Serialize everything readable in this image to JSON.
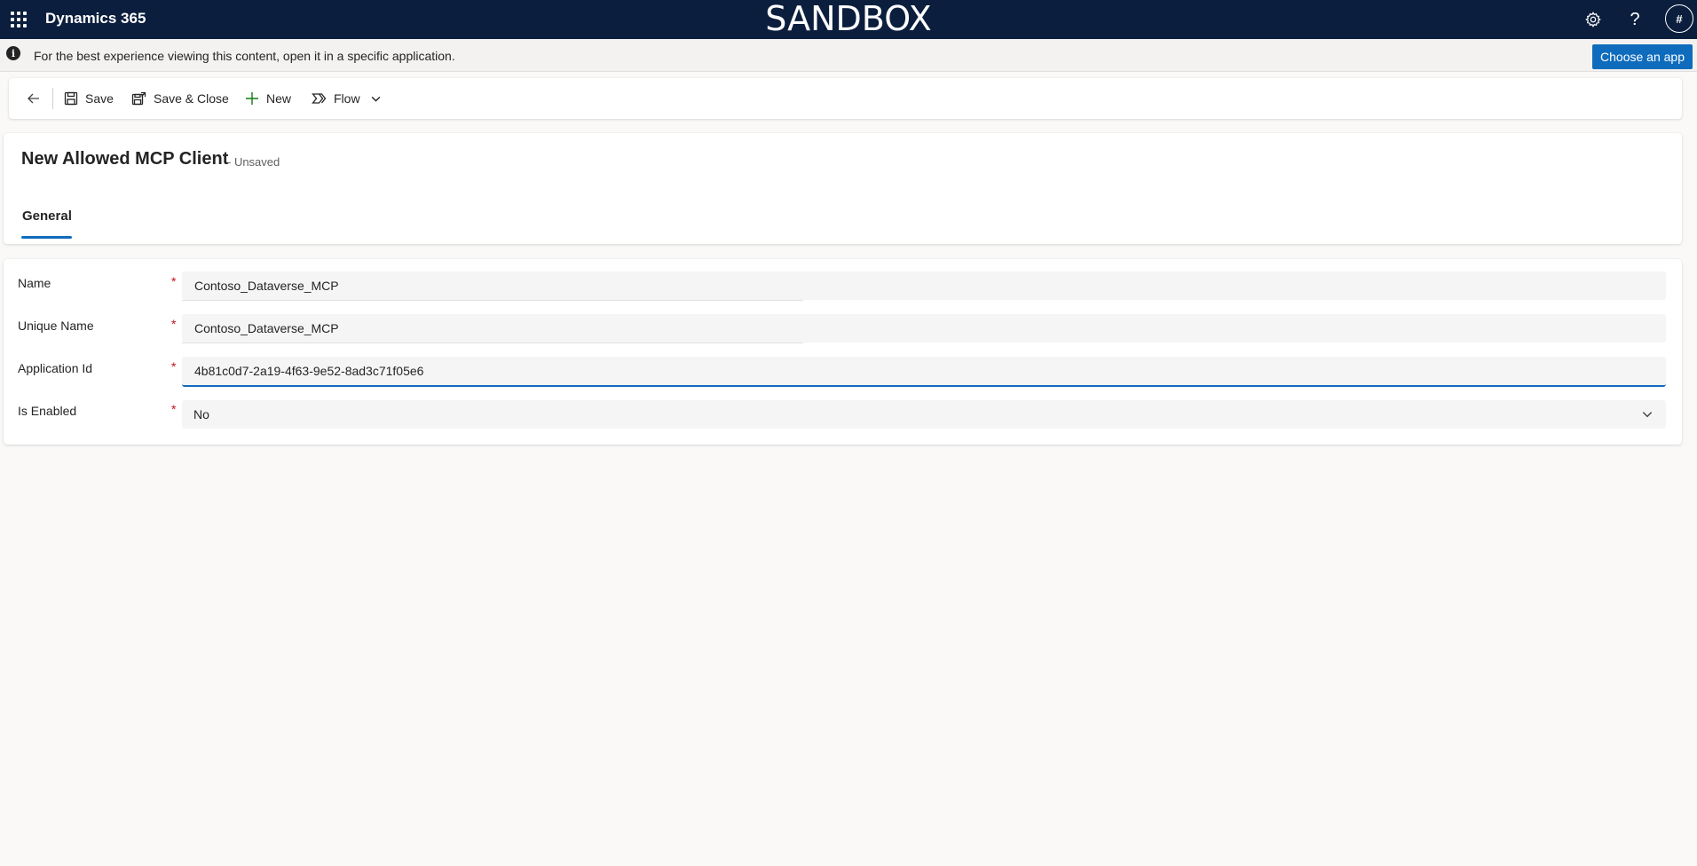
{
  "topbar": {
    "app_title": "Dynamics 365",
    "environment_banner": "SANDBOX",
    "avatar_initial": "#"
  },
  "infobar": {
    "message": "For the best experience viewing this content, open it in a specific application.",
    "button_label": "Choose an app"
  },
  "commandbar": {
    "save_label": "Save",
    "save_close_label": "Save & Close",
    "new_label": "New",
    "flow_label": "Flow"
  },
  "header": {
    "title": "New Allowed MCP Client",
    "status": "- Unsaved",
    "tabs": [
      {
        "label": "General",
        "selected": true
      }
    ]
  },
  "form": {
    "fields": [
      {
        "label": "Name",
        "required": "*",
        "value": "Contoso_Dataverse_MCP"
      },
      {
        "label": "Unique Name",
        "required": "*",
        "value": "Contoso_Dataverse_MCP"
      },
      {
        "label": "Application Id",
        "required": "*",
        "value": "4b81c0d7-2a19-4f63-9e52-8ad3c71f05e6"
      },
      {
        "label": "Is Enabled",
        "required": "*",
        "value": "No"
      }
    ]
  },
  "colors": {
    "topbar_bg": "#0b1e3d",
    "accent": "#0f6cbd",
    "required": "#c50f1f"
  }
}
